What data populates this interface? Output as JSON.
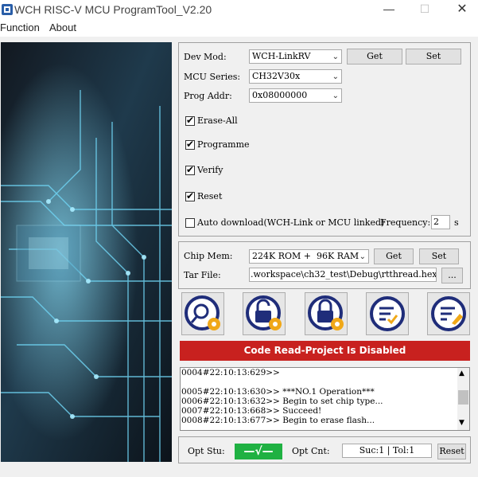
{
  "window": {
    "title": "WCH RISC-V MCU ProgramTool_V2.20"
  },
  "menu": {
    "function": "Function",
    "about": "About"
  },
  "device": {
    "dev_mod_label": "Dev Mod:",
    "dev_mod_value": "WCH-LinkRV",
    "get_label": "Get",
    "set_label": "Set",
    "mcu_series_label": "MCU Series:",
    "mcu_series_value": "CH32V30x",
    "prog_addr_label": "Prog Addr:",
    "prog_addr_value": "0x08000000"
  },
  "options": {
    "erase_all": "Erase-All",
    "programme": "Programme",
    "verify": "Verify",
    "reset": "Reset",
    "auto_download": "Auto download(WCH-Link or MCU linked)",
    "frequency_label": "Frequency:",
    "frequency_value": "2",
    "frequency_unit": "s"
  },
  "chip": {
    "mem_label": "Chip Mem:",
    "mem_value": "224K ROM +  96K RAM",
    "get_label": "Get",
    "set_label": "Set",
    "tar_label": "Tar File:",
    "tar_value": ".workspace\\ch32_test\\Debug\\rtthread.hex",
    "browse_label": "..."
  },
  "banner": {
    "text": "Code Read-Project Is Disabled"
  },
  "log": {
    "lines": [
      "0004#22:10:13:629>>",
      "",
      "0005#22:10:13:630>> ***NO.1 Operation***",
      "0006#22:10:13:632>> Begin to set chip type...",
      "0007#22:10:13:668>> Succeed!",
      "0008#22:10:13:677>> Begin to erase flash..."
    ]
  },
  "status": {
    "opt_stu_label": "Opt Stu:",
    "opt_stu_mark": "—√—",
    "opt_cnt_label": "Opt Cnt:",
    "opt_cnt_value": "Suc:1 | Tol:1",
    "reset_label": "Reset"
  },
  "colors": {
    "banner": "#c8211f",
    "status_ok": "#1fb142",
    "icon_ring": "#1f2d7a",
    "icon_badge": "#f0a818"
  },
  "icons": [
    "search-chip-icon",
    "unlock-chip-icon",
    "lock-chip-icon",
    "verify-list-icon",
    "erase-list-icon"
  ]
}
